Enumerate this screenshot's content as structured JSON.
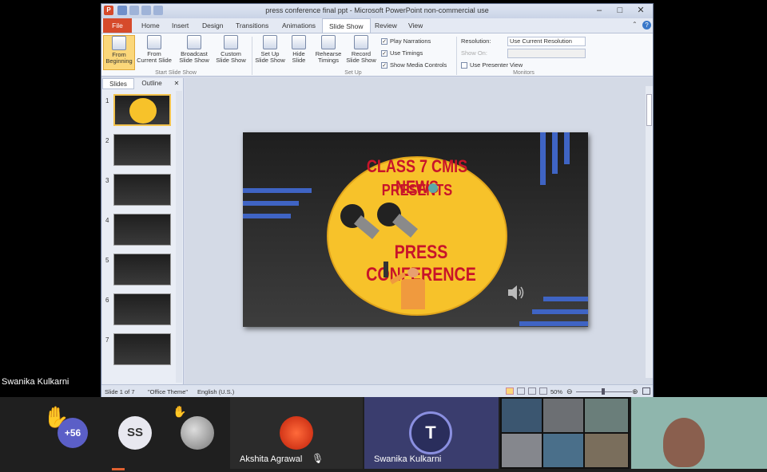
{
  "window": {
    "title": "press conference final ppt - Microsoft PowerPoint non-commercial use",
    "controls": [
      "–",
      "□",
      "✕"
    ]
  },
  "ribbon_tabs": [
    "File",
    "Home",
    "Insert",
    "Design",
    "Transitions",
    "Animations",
    "Slide Show",
    "Review",
    "View"
  ],
  "ribbon": {
    "buttons": [
      {
        "label": "From Beginning"
      },
      {
        "label": "From Current Slide"
      },
      {
        "label": "Broadcast Slide Show"
      },
      {
        "label": "Custom Slide Show"
      },
      {
        "label": "Set Up Slide Show"
      },
      {
        "label": "Hide Slide"
      },
      {
        "label": "Rehearse Timings"
      },
      {
        "label": "Record Slide Show"
      }
    ],
    "checks": [
      {
        "label": "Play Narrations",
        "checked": true
      },
      {
        "label": "Use Timings",
        "checked": true
      },
      {
        "label": "Show Media Controls",
        "checked": true
      }
    ],
    "groups": [
      "Start Slide Show",
      "Set Up",
      "Monitors"
    ],
    "resolution_label": "Resolution:",
    "resolution_value": "Use Current Resolution",
    "show_on_label": "Show On:",
    "presenter_view_label": "Use Presenter View"
  },
  "pane": {
    "tabs": [
      "Slides",
      "Outline"
    ],
    "close": "✕",
    "slide_numbers": [
      "1",
      "2",
      "3",
      "4",
      "5",
      "6",
      "7"
    ],
    "selected_slide": 1
  },
  "slide": {
    "line1": "CLASS 7 CMIS NEWS",
    "line2": "PRESENTS",
    "line3": "PRESS CONFERENCE"
  },
  "status": {
    "slide_count": "Slide 1 of 7",
    "theme": "\"Office Theme\"",
    "language": "English (U.S.)",
    "zoom": "50%"
  },
  "meeting": {
    "presenter_name_overlay": "Swanika Kulkarni",
    "raised_count": "+56",
    "initials": "SS",
    "participants": [
      {
        "name": "Akshita Agrawal",
        "muted": true
      },
      {
        "name": "Swanika Kulkarni"
      }
    ]
  },
  "colors": {
    "accent_file_tab": "#d64a2b",
    "slide_yellow": "#f7c22a",
    "slide_red": "#c8142a",
    "slide_blue": "#3f64c4"
  }
}
